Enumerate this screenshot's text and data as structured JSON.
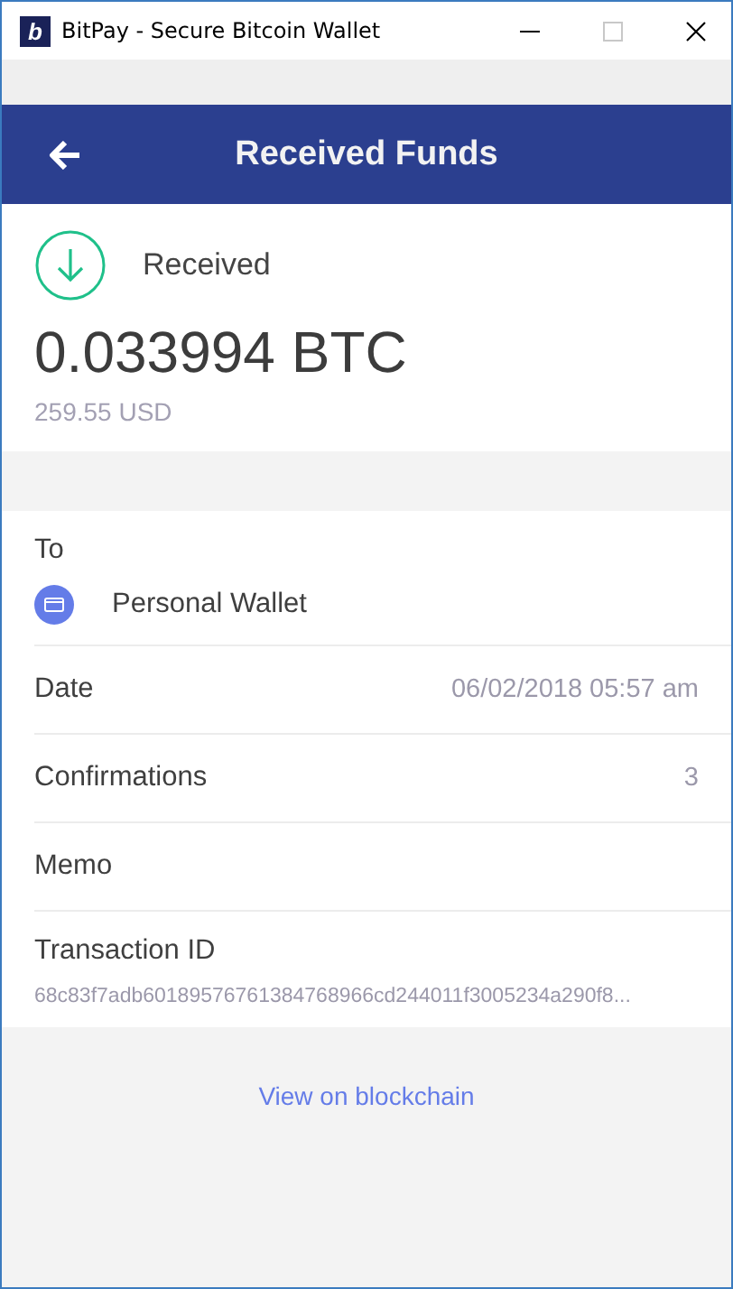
{
  "window": {
    "logo": "b",
    "title": "BitPay - Secure Bitcoin Wallet"
  },
  "header": {
    "title": "Received Funds"
  },
  "summary": {
    "status": "Received",
    "amount": "0.033994 BTC",
    "fiat": "259.55 USD"
  },
  "details": [
    {
      "kind": "wallet",
      "label": "To",
      "value": "Personal Wallet"
    },
    {
      "kind": "inline",
      "label": "Date",
      "value": "06/02/2018 05:57 am"
    },
    {
      "kind": "inline",
      "label": "Confirmations",
      "value": "3"
    },
    {
      "kind": "empty",
      "label": "Memo"
    },
    {
      "kind": "stacked",
      "label": "Transaction ID",
      "value": "68c83f7adb60189576761384768966cd244011f3005234a290f8..."
    }
  ],
  "link": "View on blockchain"
}
